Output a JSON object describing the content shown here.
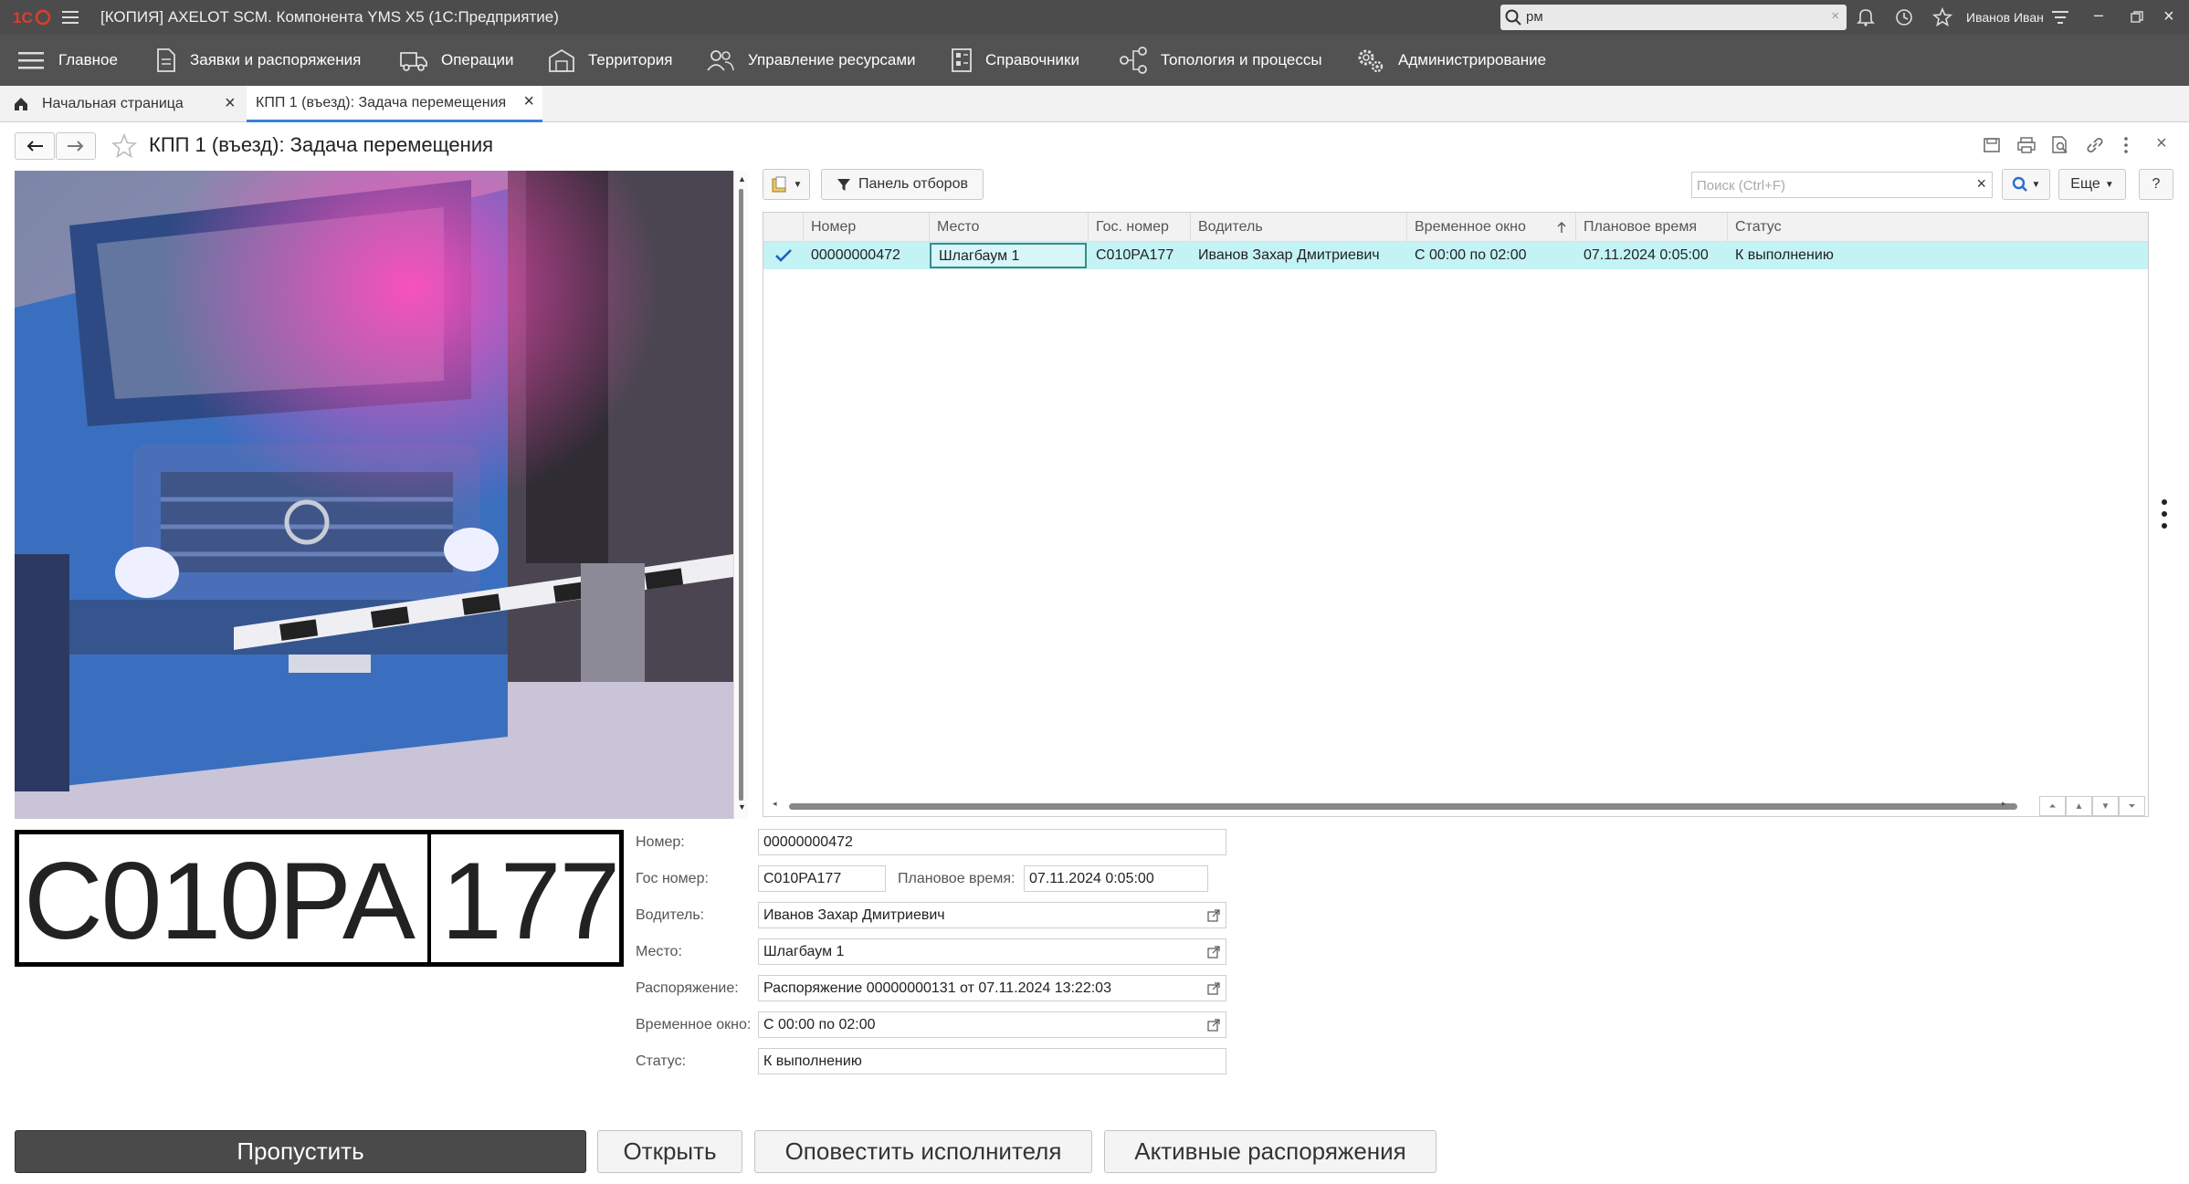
{
  "window": {
    "title": "[КОПИЯ] AXELOT SCM. Компонента YMS X5  (1С:Предприятие)",
    "search_value": "рм",
    "user": "Иванов Иван"
  },
  "nav": {
    "items": [
      "Главное",
      "Заявки и распоряжения",
      "Операции",
      "Территория",
      "Управление ресурсами",
      "Справочники",
      "Топология и процессы",
      "Администрирование"
    ]
  },
  "tabs": {
    "home": "Начальная страница",
    "active": "КПП 1 (въезд): Задача перемещения"
  },
  "page": {
    "title": "КПП 1 (въезд): Задача перемещения"
  },
  "toolbar": {
    "filter_label": "Панель отборов",
    "search_placeholder": "Поиск (Ctrl+F)",
    "more_label": "Еще",
    "help_label": "?"
  },
  "grid": {
    "columns": [
      "Номер",
      "Место",
      "Гос. номер",
      "Водитель",
      "Временное окно",
      "Плановое время",
      "Статус"
    ],
    "rows": [
      {
        "number": "00000000472",
        "place": "Шлагбаум 1",
        "plate": "С010РА177",
        "driver": "Иванов Захар Дмитриевич",
        "window": "С 00:00 по 02:00",
        "planned": "07.11.2024 0:05:00",
        "status": "К выполнению"
      }
    ]
  },
  "plate": {
    "main": "С010РА",
    "region": "177"
  },
  "form": {
    "number_label": "Номер:",
    "number": "00000000472",
    "gos_label": "Гос номер:",
    "gos": "С010РА177",
    "planned_label": "Плановое время:",
    "planned": "07.11.2024  0:05:00",
    "driver_label": "Водитель:",
    "driver": "Иванов Захар Дмитриевич",
    "place_label": "Место:",
    "place": "Шлагбаум 1",
    "order_label": "Распоряжение:",
    "order": "Распоряжение 00000000131 от 07.11.2024 13:22:03",
    "window_label": "Временное окно:",
    "window": "С 00:00 по 02:00",
    "status_label": "Статус:",
    "status": "К выполнению"
  },
  "buttons": {
    "pass": "Пропустить",
    "open": "Открыть",
    "notify": "Оповестить исполнителя",
    "active_orders": "Активные распоряжения"
  },
  "colors": {
    "titlebar": "#4c4c4c",
    "navbar": "#525252",
    "row_highlight": "#c4f3f6",
    "pass_button": "#4a4a4a",
    "accent": "#3a7fd8"
  }
}
